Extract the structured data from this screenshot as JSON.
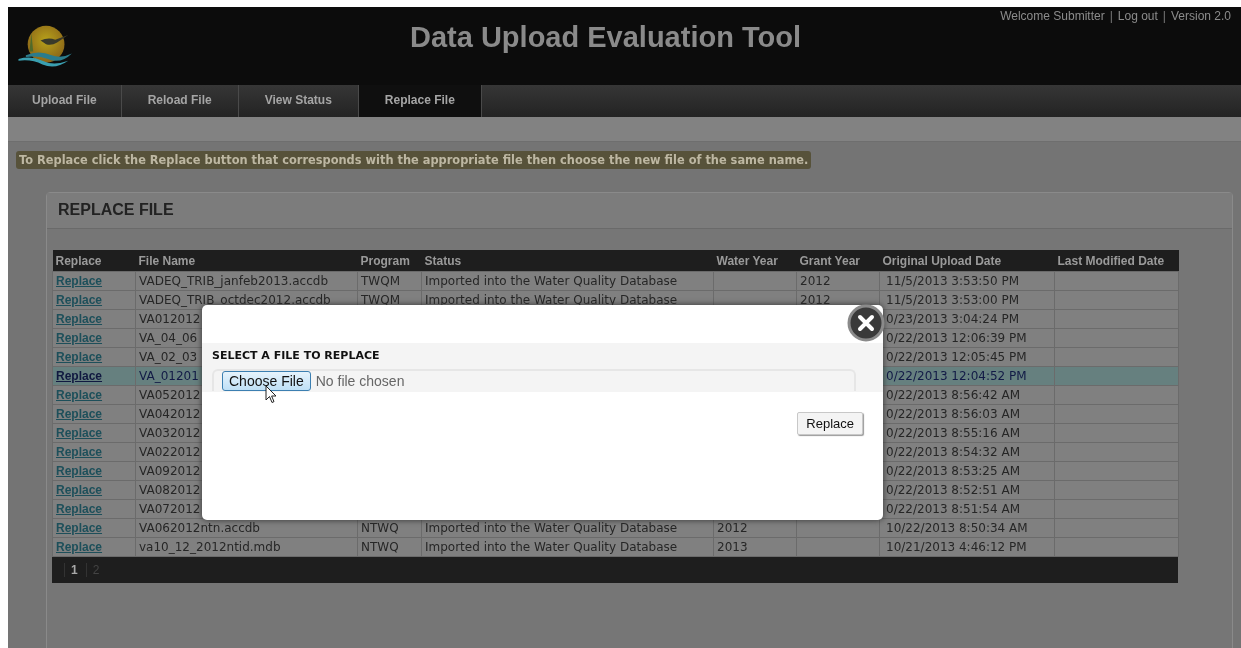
{
  "header": {
    "title": "Data Upload Evaluation Tool",
    "user_bar": [
      {
        "kind": "text",
        "text": "Welcome Submitter"
      },
      {
        "kind": "separator",
        "text": "|"
      },
      {
        "kind": "link",
        "text": "Log out"
      },
      {
        "kind": "separator",
        "text": "|"
      },
      {
        "kind": "text",
        "text": "Version 2.0"
      }
    ]
  },
  "tabs": [
    {
      "label": "Upload File",
      "selected": false
    },
    {
      "label": "Reload File",
      "selected": false
    },
    {
      "label": "View Status",
      "selected": false
    },
    {
      "label": "Replace File",
      "selected": true
    }
  ],
  "instruction": "To Replace click the Replace button that corresponds with the appropriate file then choose the new file of the same name.",
  "panel": {
    "title": "REPLACE FILE",
    "table": {
      "columns": [
        "Replace",
        "File Name",
        "Program",
        "Status",
        "Water Year",
        "Grant Year",
        "Original Upload Date",
        "Last Modified Date"
      ],
      "rows": [
        {
          "selected": false,
          "replace": "Replace",
          "file_name": "VADEQ_TRIB_janfeb2013.accdb",
          "program": "TWQM",
          "status": "Imported into the Water Quality Database",
          "grant_year": "2012",
          "upload_date": "11/5/2013 3:53:50 PM"
        },
        {
          "selected": false,
          "replace": "Replace",
          "file_name": "VADEQ_TRIB_octdec2012.accdb",
          "program": "TWQM",
          "status": "Imported into the Water Quality Database",
          "grant_year": "2012",
          "upload_date": "11/5/2013 3:53:00 PM"
        },
        {
          "selected": false,
          "replace": "Replace",
          "file_name": "VA012012",
          "upload_date": "0/23/2013 3:04:24 PM"
        },
        {
          "selected": false,
          "replace": "Replace",
          "file_name": "VA_04_06",
          "upload_date": "0/22/2013 12:06:39 PM"
        },
        {
          "selected": false,
          "replace": "Replace",
          "file_name": "VA_02_03",
          "upload_date": "0/22/2013 12:05:45 PM"
        },
        {
          "selected": true,
          "replace": "Replace",
          "file_name": "VA_01201",
          "upload_date": "0/22/2013 12:04:52 PM"
        },
        {
          "selected": false,
          "replace": "Replace",
          "file_name": "VA052012",
          "upload_date": "0/22/2013 8:56:42 AM"
        },
        {
          "selected": false,
          "replace": "Replace",
          "file_name": "VA042012",
          "upload_date": "0/22/2013 8:56:03 AM"
        },
        {
          "selected": false,
          "replace": "Replace",
          "file_name": "VA032012",
          "upload_date": "0/22/2013 8:55:16 AM"
        },
        {
          "selected": false,
          "replace": "Replace",
          "file_name": "VA022012",
          "upload_date": "0/22/2013 8:54:32 AM"
        },
        {
          "selected": false,
          "replace": "Replace",
          "file_name": "VA092012",
          "upload_date": "0/22/2013 8:53:25 AM"
        },
        {
          "selected": false,
          "replace": "Replace",
          "file_name": "VA082012",
          "upload_date": "0/22/2013 8:52:51 AM"
        },
        {
          "selected": false,
          "replace": "Replace",
          "file_name": "VA072012",
          "upload_date": "0/22/2013 8:51:54 AM"
        },
        {
          "selected": false,
          "replace": "Replace",
          "file_name": "VA062012ntn.accdb",
          "program": "NTWQ",
          "status": "Imported into the Water Quality Database",
          "water_year": "2012",
          "upload_date": "10/22/2013 8:50:34 AM"
        },
        {
          "selected": false,
          "replace": "Replace",
          "file_name": "va10_12_2012ntid.mdb",
          "program": "NTWQ",
          "status": "Imported into the Water Quality Database",
          "water_year": "2013",
          "upload_date": "10/21/2013 4:46:12 PM"
        }
      ]
    },
    "pager": [
      {
        "label": "1",
        "selected": true
      },
      {
        "label": "2",
        "selected": false
      }
    ]
  },
  "dialog": {
    "heading": "SELECT A FILE TO REPLACE",
    "choose_button": "Choose File",
    "file_status": "No file chosen",
    "submit_button": "Replace"
  }
}
